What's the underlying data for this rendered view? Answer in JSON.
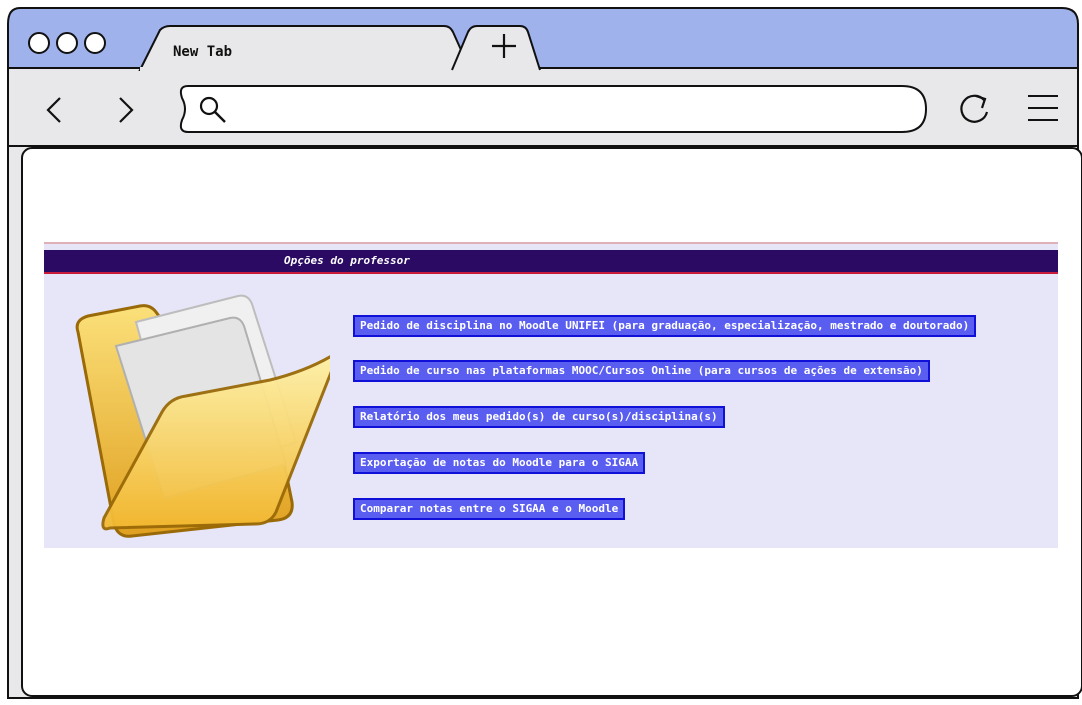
{
  "browser": {
    "tab_title": "New Tab",
    "new_tab_symbol": "+",
    "address_value": ""
  },
  "page": {
    "header_title": "Opções do professor",
    "links": [
      "Pedido de disciplina no Moodle UNIFEI (para graduação, especialização, mestrado e doutorado)",
      "Pedido de curso nas plataformas MOOC/Cursos Online (para cursos de ações de extensão)",
      "Relatório dos meus pedido(s) de curso(s)/disciplina(s)",
      "Exportação de notas do Moodle para o SIGAA",
      "Comparar notas entre o SIGAA e o Moodle"
    ]
  },
  "colors": {
    "titlebar": "#9fb2ec",
    "panel": "#e6e6f8",
    "header": "#2a0a62",
    "header_border": "#c81a3a",
    "link_bg": "#5a5ef0",
    "link_border": "#1010d8",
    "folder": "#f7c84a"
  },
  "icons": [
    "window-dots-icon",
    "back-arrow-icon",
    "forward-arrow-icon",
    "search-icon",
    "reload-icon",
    "menu-icon",
    "folder-icon"
  ]
}
